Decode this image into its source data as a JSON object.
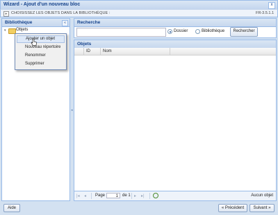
{
  "window": {
    "title": "Wizard - Ajout d'un nouveau bloc",
    "close_glyph": "x"
  },
  "stepbar": {
    "text": "CHOISISSEZ LES OBJETS DANS LA BIBLIOTHÈQUE :",
    "version": "FR-3.5.1.1"
  },
  "library": {
    "title": "Bibliothèque",
    "collapse_glyph": "«",
    "tree": [
      {
        "label": "Objets",
        "expanded": true,
        "icon": "folder-icon"
      }
    ]
  },
  "context_menu": {
    "items": [
      {
        "label": "Ajouter un objet",
        "active": true
      },
      {
        "label": "Nouveau répertoire",
        "active": false
      },
      {
        "label": "Renommer",
        "active": false
      },
      {
        "label": "Supprimer",
        "active": false
      }
    ]
  },
  "search": {
    "title": "Recherche",
    "value": "",
    "radios": [
      {
        "label": "Dossier",
        "checked": true
      },
      {
        "label": "Bibliothèque",
        "checked": false
      }
    ],
    "button_label": "Rechercher"
  },
  "objects": {
    "title": "Objets",
    "columns": [
      "",
      "ID",
      "Nom"
    ],
    "rows": []
  },
  "paging": {
    "page_label": "Page",
    "page_value": "1",
    "of_label": "de 1",
    "status": "Aucun objet"
  },
  "footer": {
    "help_label": "Aide",
    "prev_label": "« Précédent",
    "next_label": "Suivant »"
  },
  "colors": {
    "panel_border": "#99bbe8",
    "header_text": "#15428b",
    "background": "#d3e1f1"
  }
}
